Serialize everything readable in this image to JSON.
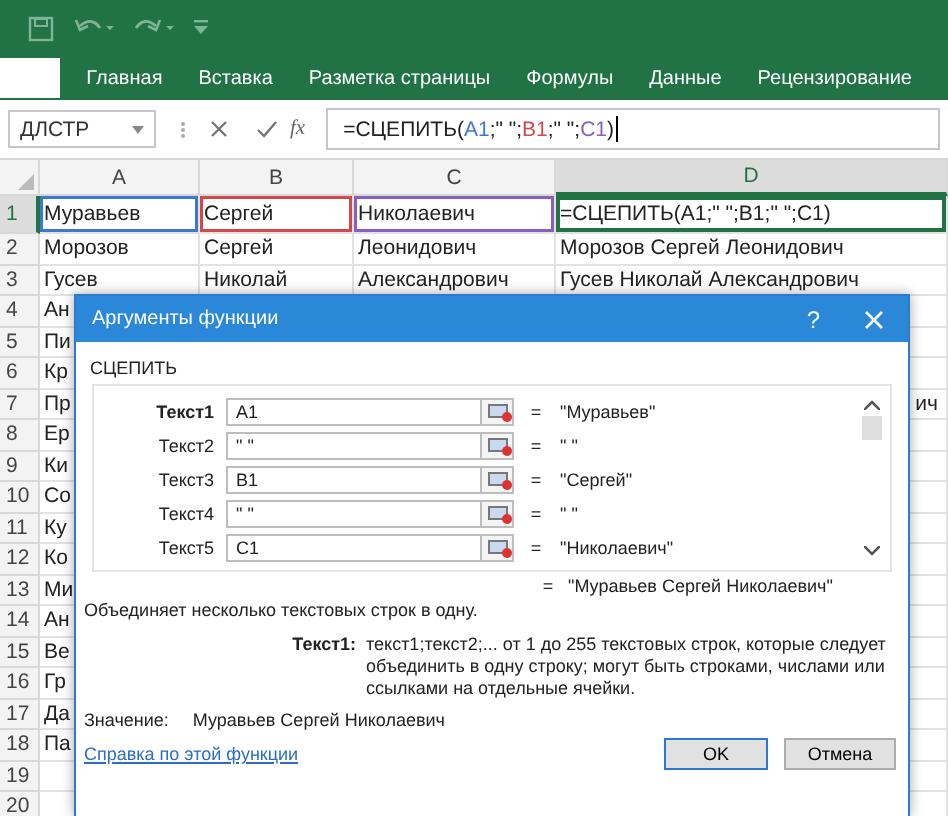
{
  "ribbon": {
    "tabs": [
      {
        "label": "Главная"
      },
      {
        "label": "Вставка"
      },
      {
        "label": "Разметка страницы"
      },
      {
        "label": "Формулы"
      },
      {
        "label": "Данные"
      },
      {
        "label": "Рецензирование"
      }
    ]
  },
  "formula_bar": {
    "name_box": "ДЛСТР",
    "fx_label": "fx",
    "formula_parts": [
      {
        "text": "=СЦЕПИТЬ("
      },
      {
        "text": "A1",
        "color": "#3b78d0"
      },
      {
        "text": ";\" \";"
      },
      {
        "text": "B1",
        "color": "#d04a4a"
      },
      {
        "text": ";\" \";"
      },
      {
        "text": "C1",
        "color": "#8a5fc4"
      },
      {
        "text": ")"
      }
    ]
  },
  "sheet": {
    "columns": [
      {
        "label": "A",
        "selected": false
      },
      {
        "label": "B",
        "selected": false
      },
      {
        "label": "C",
        "selected": false
      },
      {
        "label": "D",
        "selected": true
      }
    ],
    "rows": [
      {
        "number": "1",
        "selected": true,
        "cells": [
          {
            "text": "Муравьев",
            "color": "#3b78d0"
          },
          {
            "text": "Сергей",
            "color": "#d04a4a"
          },
          {
            "text": "Николаевич",
            "color": "#8a5fc4"
          },
          {
            "text": "=СЦЕПИТЬ(A1;\" \";B1;\" \";C1)",
            "color": "#217346"
          }
        ]
      },
      {
        "number": "2",
        "selected": false,
        "cells": [
          {
            "text": "Морозов"
          },
          {
            "text": "Сергей"
          },
          {
            "text": "Леонидович"
          },
          {
            "text": "Морозов Сергей Леонидович"
          }
        ]
      },
      {
        "number": "3",
        "selected": false,
        "cells": [
          {
            "text": "Гусев"
          },
          {
            "text": "Николай"
          },
          {
            "text": "Александрович"
          },
          {
            "text": "Гусев Николай Александрович"
          }
        ]
      },
      {
        "number": "4",
        "selected": false,
        "cells": [
          {
            "text": "Ан"
          }
        ]
      },
      {
        "number": "5",
        "selected": false,
        "cells": [
          {
            "text": "Пи"
          }
        ]
      },
      {
        "number": "6",
        "selected": false,
        "cells": [
          {
            "text": "Кр"
          }
        ]
      },
      {
        "number": "7",
        "selected": false,
        "cells": [
          {
            "text": "Пр"
          },
          {},
          {},
          {
            "text": "ич"
          }
        ]
      },
      {
        "number": "8",
        "selected": false,
        "cells": [
          {
            "text": "Ер"
          }
        ]
      },
      {
        "number": "9",
        "selected": false,
        "cells": [
          {
            "text": "Ки"
          }
        ]
      },
      {
        "number": "10",
        "selected": false,
        "cells": [
          {
            "text": "Со"
          }
        ]
      },
      {
        "number": "11",
        "selected": false,
        "cells": [
          {
            "text": "Ку"
          }
        ]
      },
      {
        "number": "12",
        "selected": false,
        "cells": [
          {
            "text": "Ко"
          }
        ]
      },
      {
        "number": "13",
        "selected": false,
        "cells": [
          {
            "text": "Ми"
          }
        ]
      },
      {
        "number": "14",
        "selected": false,
        "cells": [
          {
            "text": "Ан"
          }
        ]
      },
      {
        "number": "15",
        "selected": false,
        "cells": [
          {
            "text": "Ве"
          }
        ]
      },
      {
        "number": "16",
        "selected": false,
        "cells": [
          {
            "text": "Гр"
          }
        ]
      },
      {
        "number": "17",
        "selected": false,
        "cells": [
          {
            "text": "Да"
          }
        ]
      },
      {
        "number": "18",
        "selected": false,
        "cells": [
          {
            "text": "Па"
          }
        ]
      },
      {
        "number": "19",
        "selected": false
      },
      {
        "number": "20",
        "selected": false
      }
    ]
  },
  "dialog": {
    "title": "Аргументы функции",
    "help": "?",
    "function_name": "СЦЕПИТЬ",
    "arguments": [
      {
        "label": "Текст1",
        "value": "A1",
        "equals": "=",
        "result": "\"Муравьев\"",
        "selected": true
      },
      {
        "label": "Текст2",
        "value": "\" \"",
        "equals": "=",
        "result": "\" \"",
        "selected": false
      },
      {
        "label": "Текст3",
        "value": "B1",
        "equals": "=",
        "result": "\"Сергей\"",
        "selected": false
      },
      {
        "label": "Текст4",
        "value": "\" \"",
        "equals": "=",
        "result": "\" \"",
        "selected": false
      },
      {
        "label": "Текст5",
        "value": "C1",
        "equals": "=",
        "result": "\"Николаевич\"",
        "selected": false
      }
    ],
    "result": {
      "equals": "=",
      "value": "\"Муравьев Сергей Николаевич\""
    },
    "description": "Объединяет несколько текстовых строк в одну.",
    "arg_help": {
      "label": "Текст1:",
      "text": "текст1;текст2;... от 1 до 255 текстовых строк, которые следует объединить в одну строку; могут быть строками, числами или ссылками на отдельные ячейки."
    },
    "value": {
      "label": "Значение:",
      "text": "Муравьев Сергей Николаевич"
    },
    "help_link": "Справка по этой функции",
    "buttons": [
      "OK",
      "Отмена"
    ]
  }
}
